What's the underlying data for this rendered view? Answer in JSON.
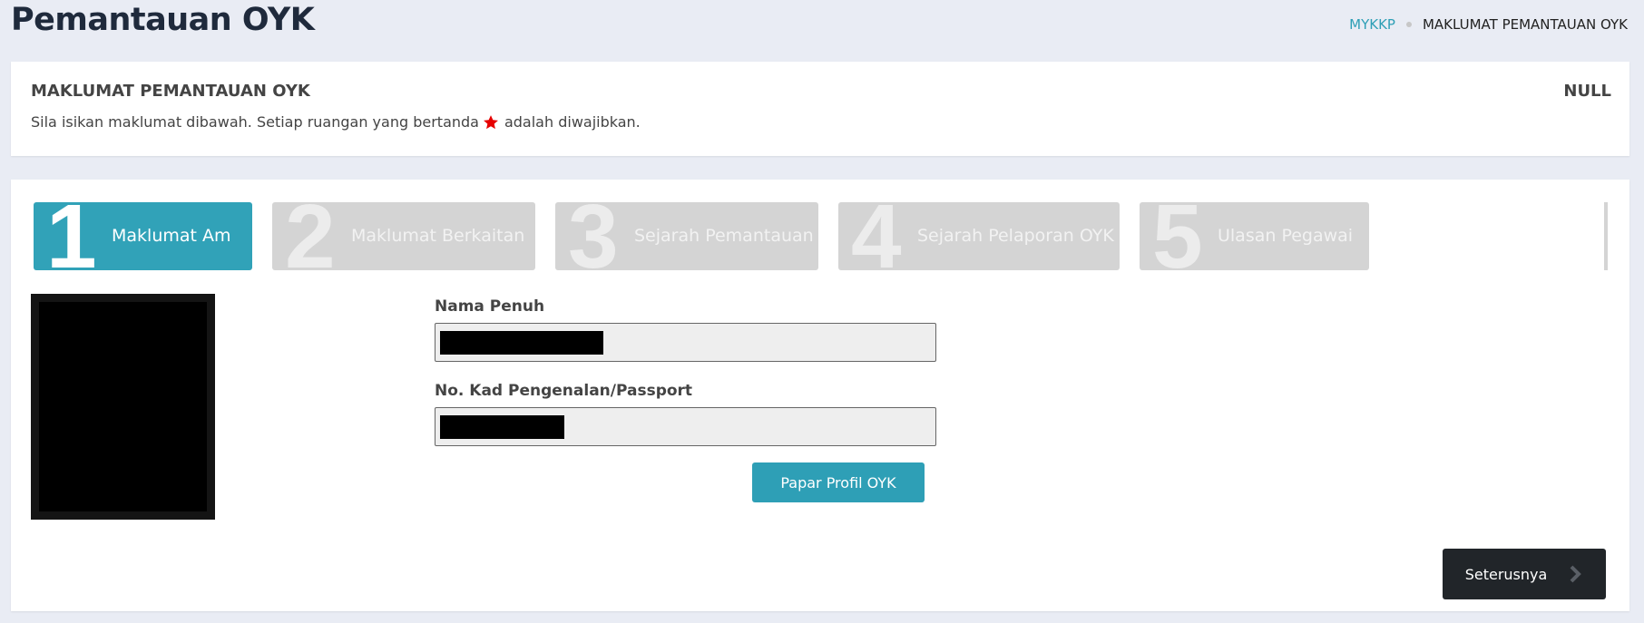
{
  "header": {
    "title": "Pemantauan OYK",
    "breadcrumb": [
      "MYKKP",
      "MAKLUMAT PEMANTAUAN OYK"
    ]
  },
  "info": {
    "title": "MAKLUMAT PEMANTAUAN OYK",
    "status": "NULL",
    "description_before": "Sila isikan maklumat dibawah. Setiap ruangan yang bertanda",
    "description_after": "adalah diwajibkan."
  },
  "steps": [
    {
      "number": "1",
      "label": "Maklumat Am",
      "active": true
    },
    {
      "number": "2",
      "label": "Maklumat Berkaitan",
      "active": false
    },
    {
      "number": "3",
      "label": "Sejarah Pemantauan",
      "active": false
    },
    {
      "number": "4",
      "label": "Sejarah Pelaporan OYK",
      "active": false
    },
    {
      "number": "5",
      "label": "Ulasan Pegawai",
      "active": false
    }
  ],
  "form": {
    "name_label": "Nama Penuh",
    "ic_label": "No. Kad Pengenalan/Passport",
    "profile_button": "Papar Profil OYK"
  },
  "next_button": "Seterusnya",
  "colors": {
    "accent": "#2e9fb6",
    "dark": "#212529",
    "required_star": "#e60000"
  }
}
